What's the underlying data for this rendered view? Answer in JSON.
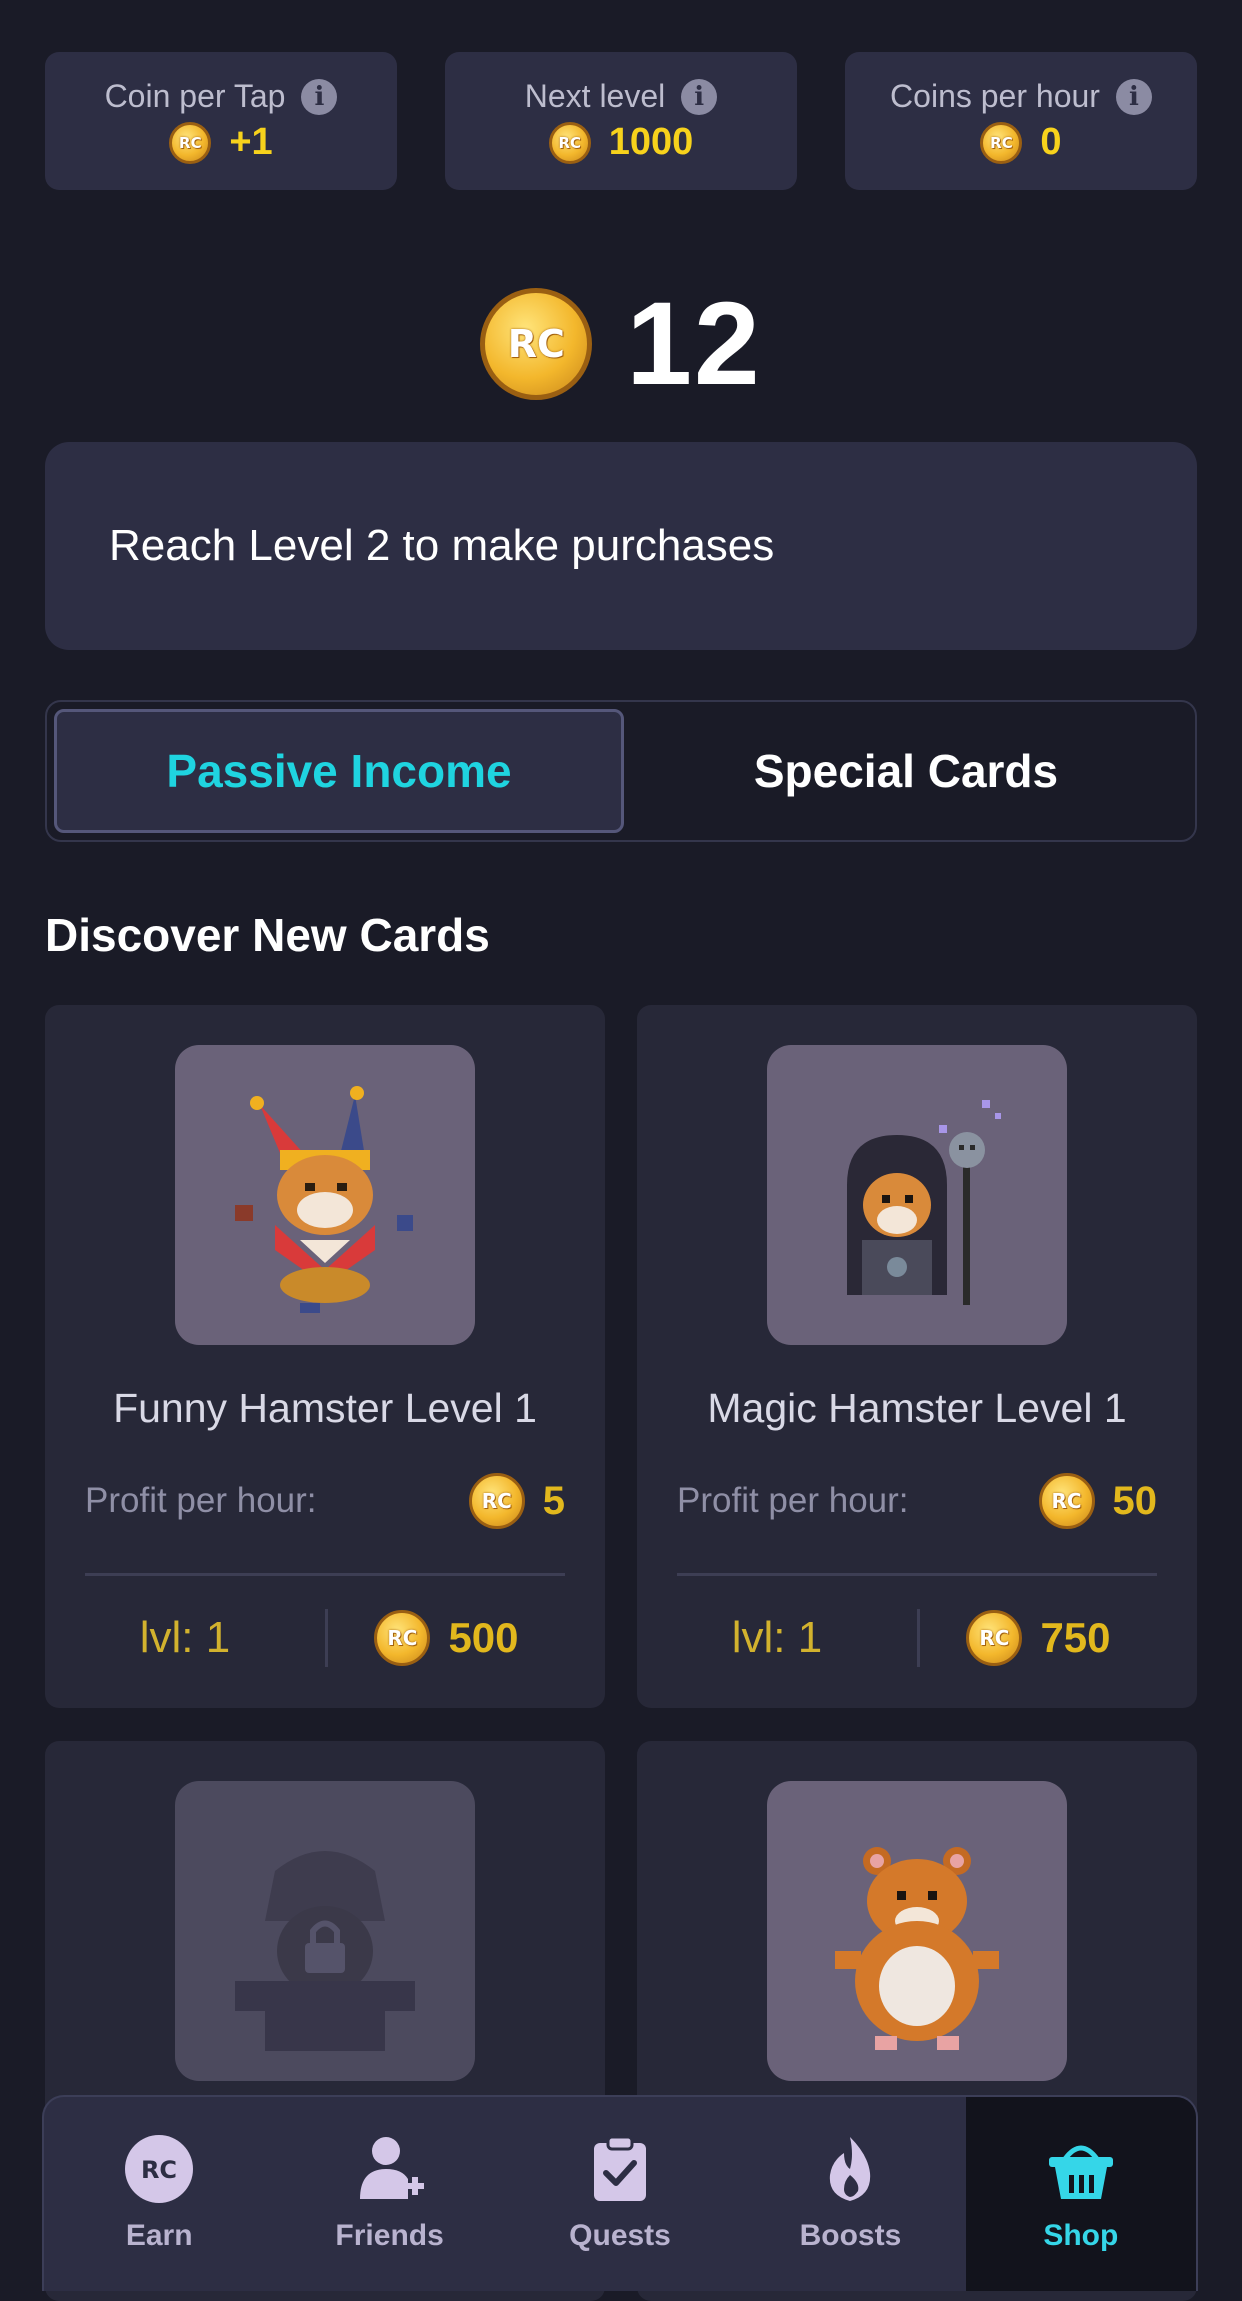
{
  "stats": [
    {
      "label": "Coin per Tap",
      "value": "+1"
    },
    {
      "label": "Next level",
      "value": "1000"
    },
    {
      "label": "Coins per hour",
      "value": "0"
    }
  ],
  "coin_symbol": "RC",
  "balance": "12",
  "notice": "Reach Level 2 to make purchases",
  "tabs": {
    "passive": "Passive Income",
    "special": "Special Cards",
    "active": "Passive Income"
  },
  "section_title": "Discover New Cards",
  "cards": [
    {
      "name": "Funny Hamster Level 1",
      "profit_label": "Profit per hour:",
      "profit": "5",
      "level": "lvl: 1",
      "price": "500"
    },
    {
      "name": "Magic Hamster Level 1",
      "profit_label": "Profit per hour:",
      "profit": "50",
      "level": "lvl: 1",
      "price": "750"
    }
  ],
  "nav": [
    {
      "label": "Earn",
      "icon": "rc-coin-icon"
    },
    {
      "label": "Friends",
      "icon": "add-user-icon"
    },
    {
      "label": "Quests",
      "icon": "clipboard-check-icon"
    },
    {
      "label": "Boosts",
      "icon": "flame-icon"
    },
    {
      "label": "Shop",
      "icon": "basket-icon"
    }
  ],
  "active_nav": "Shop",
  "colors": {
    "background": "#1a1b27",
    "panel": "#2d2e44",
    "accent_cyan": "#1fd4e0",
    "gold": "#f7d21c"
  }
}
